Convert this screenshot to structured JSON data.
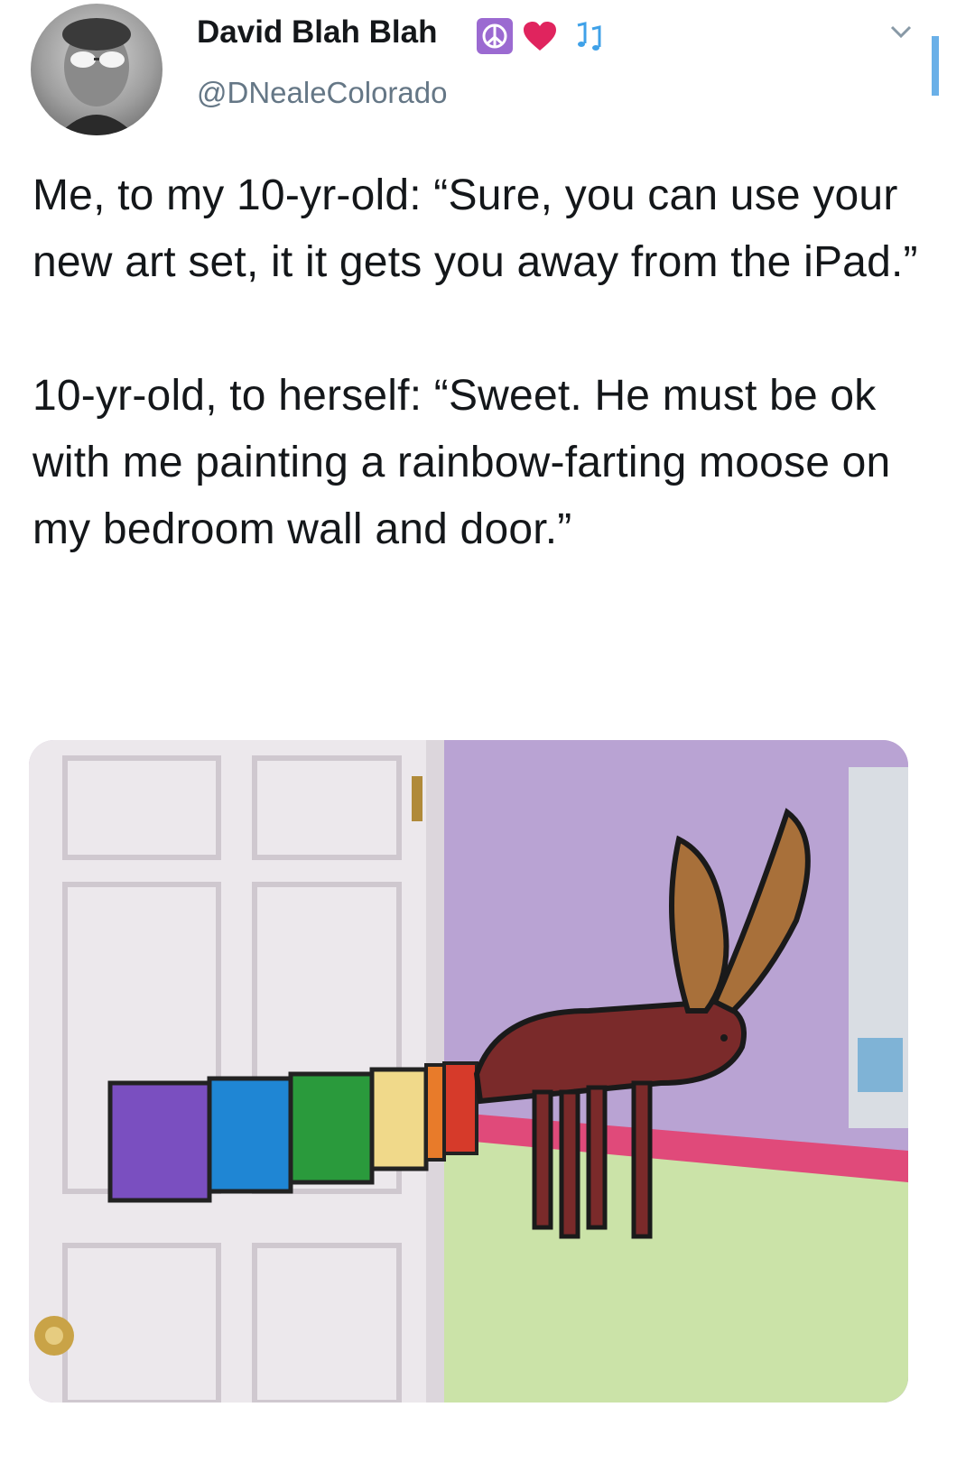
{
  "tweet": {
    "display_name": "David Blah Blah",
    "handle": "@DNealeColorado",
    "text": "Me, to my 10-yr-old: “Sure, you can use your new art set, it it gets you away from the iPad.”\n\n10-yr-old, to herself: “Sweet. He must be ok with me painting a rainbow-farting moose on my bedroom wall and door.”",
    "badges": [
      "peace-icon",
      "heart-icon",
      "music-notes-icon"
    ],
    "colors": {
      "name": "#14171a",
      "handle": "#657786",
      "text": "#14171a",
      "peace_badge": "#9b6ad1",
      "heart": "#e0245e",
      "music": "#3fa1e8"
    }
  },
  "photo": {
    "rainbow_colors": [
      "#7a4fc0",
      "#1f86d4",
      "#2a9a3c",
      "#f0d98a",
      "#e87b2a",
      "#d63a2a"
    ],
    "moose_color": "#7a2a2a",
    "antler_color": "#a8703a"
  }
}
